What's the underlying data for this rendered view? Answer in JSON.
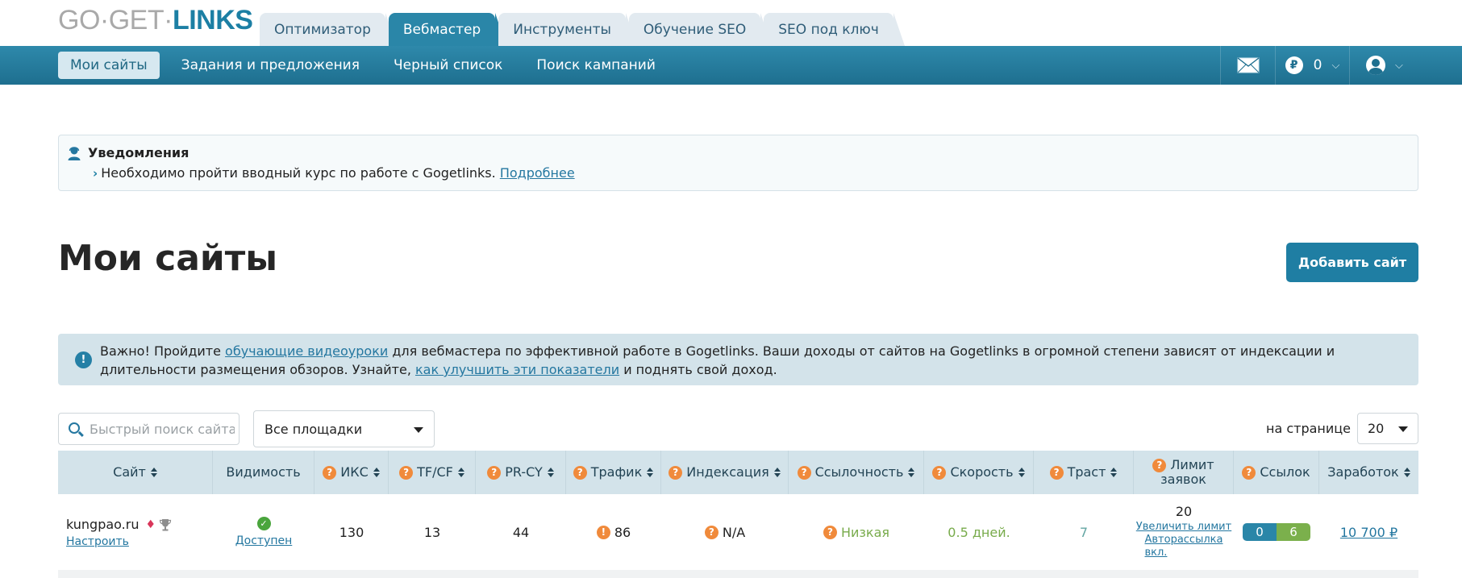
{
  "logo": {
    "part1": "GO·GET·",
    "part2": "LINKS"
  },
  "tabs": [
    {
      "label": "Оптимизатор",
      "active": false
    },
    {
      "label": "Вебмастер",
      "active": true
    },
    {
      "label": "Инструменты",
      "active": false
    },
    {
      "label": "Обучение SEO",
      "active": false
    },
    {
      "label": "SEO под ключ",
      "active": false
    }
  ],
  "nav": {
    "items": [
      {
        "label": "Мои сайты",
        "active": true
      },
      {
        "label": "Задания и предложения",
        "active": false
      },
      {
        "label": "Черный список",
        "active": false
      },
      {
        "label": "Поиск кампаний",
        "active": false
      }
    ],
    "currency_symbol": "₽",
    "balance": "0"
  },
  "notifications": {
    "title": "Уведомления",
    "text": "Необходимо пройти вводный курс по работе с Gogetlinks.",
    "link": "Подробнее"
  },
  "page": {
    "title": "Мои сайты",
    "add_button": "Добавить сайт"
  },
  "info": {
    "t1": "Важно! Пройдите ",
    "link1": "обучающие видеоуроки",
    "t2": " для вебмастера по эффективной работе в Gogetlinks. Ваши доходы от сайтов на Gogetlinks в огромной степени зависят от индексации и длительности размещения обзоров. Узнайте, ",
    "link2": "как улучшить эти показатели",
    "t3": " и поднять свой доход."
  },
  "filters": {
    "search_placeholder": "Быстрый поиск сайта",
    "platform": "Все площадки",
    "per_page_label": "на странице",
    "per_page": "20"
  },
  "table": {
    "headers": {
      "site": "Сайт",
      "visibility": "Видимость",
      "iks": "ИКС",
      "tfcf": "TF/CF",
      "prcy": "PR-CY",
      "traffic": "Трафик",
      "indexing": "Индексация",
      "linkiness": "Ссылочность",
      "speed": "Скорость",
      "trust": "Траст",
      "limit1": "Лимит",
      "limit2": "заявок",
      "links": "Ссылок",
      "earnings": "Заработок"
    },
    "rows": [
      {
        "site": "kungpao.ru",
        "configure": "Настроить",
        "visibility": "Доступен",
        "iks": "130",
        "tfcf": "13",
        "prcy": "44",
        "traffic": "86",
        "indexing": "N/A",
        "linkiness": "Низкая",
        "speed": "0.5 дней.",
        "trust": "7",
        "limit": "20",
        "limit_increase": "Увеличить лимит",
        "autosend1": "Авторассылка",
        "autosend2": "вкл.",
        "links_a": "0",
        "links_b": "6",
        "earnings": "10 700 ₽"
      }
    ]
  }
}
